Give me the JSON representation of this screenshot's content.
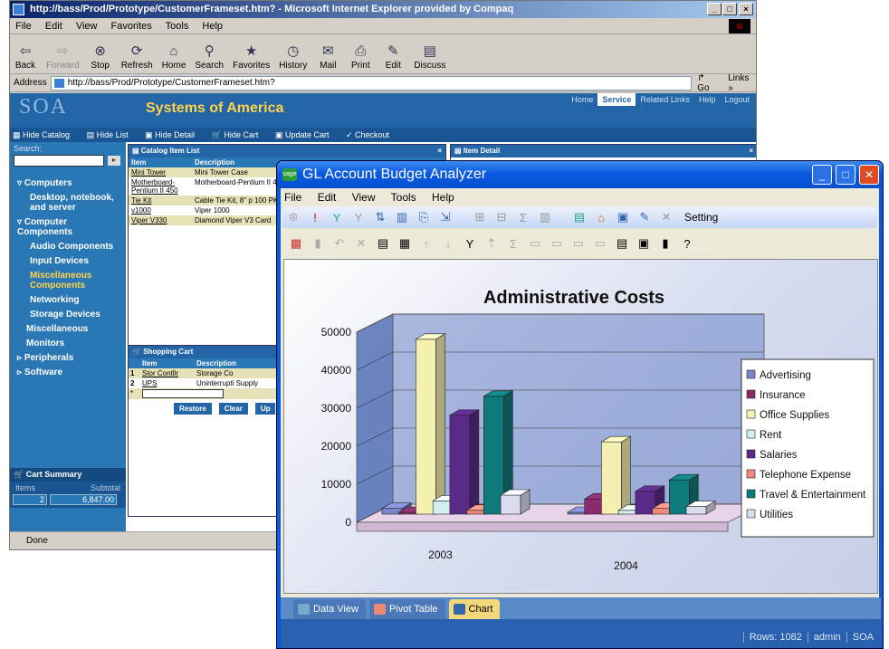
{
  "ie": {
    "title": "http://bass/Prod/Prototype/CustomerFrameset.htm? - Microsoft Internet Explorer provided by Compaq",
    "menu": [
      "File",
      "Edit",
      "View",
      "Favorites",
      "Tools",
      "Help"
    ],
    "toolbar": [
      "Back",
      "Forward",
      "Stop",
      "Refresh",
      "Home",
      "Search",
      "Favorites",
      "History",
      "Mail",
      "Print",
      "Edit",
      "Discuss"
    ],
    "address_label": "Address",
    "address": "http://bass/Prod/Prototype/CustomerFrameset.htm?",
    "go": "Go",
    "links": "Links »",
    "status": "Done"
  },
  "soa": {
    "logo": "SOA",
    "name": "Systems of America",
    "nav": [
      "Home",
      "Service",
      "Related Links",
      "Help",
      "Logout"
    ],
    "actions": [
      "Hide Catalog",
      "Hide List",
      "Hide Detail",
      "Hide Cart",
      "Update Cart",
      "Checkout"
    ],
    "search_label": "Search:",
    "categories": [
      "Computers",
      "Desktop, notebook, and server",
      "Computer Components",
      "Audio Components",
      "Input Devices",
      "Miscellaneous Components",
      "Networking",
      "Storage Devices",
      "Miscellaneous",
      "Monitors",
      "Peripherals",
      "Software"
    ],
    "cart_summary": {
      "title": "Cart Summary",
      "items_label": "Items",
      "subtotal_label": "Subtotal",
      "items": "2",
      "subtotal": "6,847.00"
    },
    "catalog": {
      "title": "Catalog Item List",
      "col_item": "Item",
      "col_desc": "Description",
      "rows": [
        [
          "Mini Tower",
          "Mini Tower Case"
        ],
        [
          "Motherboard-Pentium II 450",
          "Motherboard-Pentium II 450"
        ],
        [
          "Tie Kit",
          "Cable Tie Kit, 8\" p 100 PK"
        ],
        [
          "v1000",
          "Viper 1000"
        ],
        [
          "Viper V330",
          "Diamond Viper V3 Card"
        ]
      ]
    },
    "detail": {
      "title": "Item Detail"
    },
    "cart": {
      "title": "Shopping Cart",
      "col_item": "Item",
      "col_desc": "Description",
      "rows": [
        [
          "1",
          "Stor Contllr",
          "Storage Co"
        ],
        [
          "2",
          "UPS",
          "Uninterrupti Supply"
        ]
      ],
      "buttons": [
        "Restore",
        "Clear",
        "Up"
      ]
    }
  },
  "gl": {
    "title": "GL Account Budget Analyzer",
    "menu": [
      "File",
      "Edit",
      "View",
      "Tools",
      "Help"
    ],
    "setting": "Setting",
    "tabs": [
      "Data View",
      "Pivot Table",
      "Chart"
    ],
    "status": [
      "Rows: 1082",
      "admin",
      "SOA"
    ]
  },
  "chart_data": {
    "type": "bar",
    "title": "Administrative Costs",
    "categories": [
      "2003",
      "2004"
    ],
    "ylim": [
      0,
      50000
    ],
    "yticks": [
      0,
      10000,
      20000,
      30000,
      40000,
      50000
    ],
    "legend_position": "right",
    "series": [
      {
        "name": "Advertising",
        "color": "#7b86c8",
        "values": [
          1500,
          0
        ]
      },
      {
        "name": "Insurance",
        "color": "#8a2b6e",
        "values": [
          0,
          4000
        ]
      },
      {
        "name": "Office Supplies",
        "color": "#f4f1b0",
        "values": [
          46000,
          19000
        ]
      },
      {
        "name": "Rent",
        "color": "#d2eef0",
        "values": [
          3500,
          1000
        ]
      },
      {
        "name": "Salaries",
        "color": "#5a2a88",
        "values": [
          26000,
          6000
        ]
      },
      {
        "name": "Telephone Expense",
        "color": "#f08a7c",
        "values": [
          1000,
          1500
        ]
      },
      {
        "name": "Travel & Entertainment",
        "color": "#0f7a7c",
        "values": [
          31000,
          9000
        ]
      },
      {
        "name": "Utilities",
        "color": "#dcdcf0",
        "values": [
          5000,
          2000
        ]
      }
    ]
  }
}
